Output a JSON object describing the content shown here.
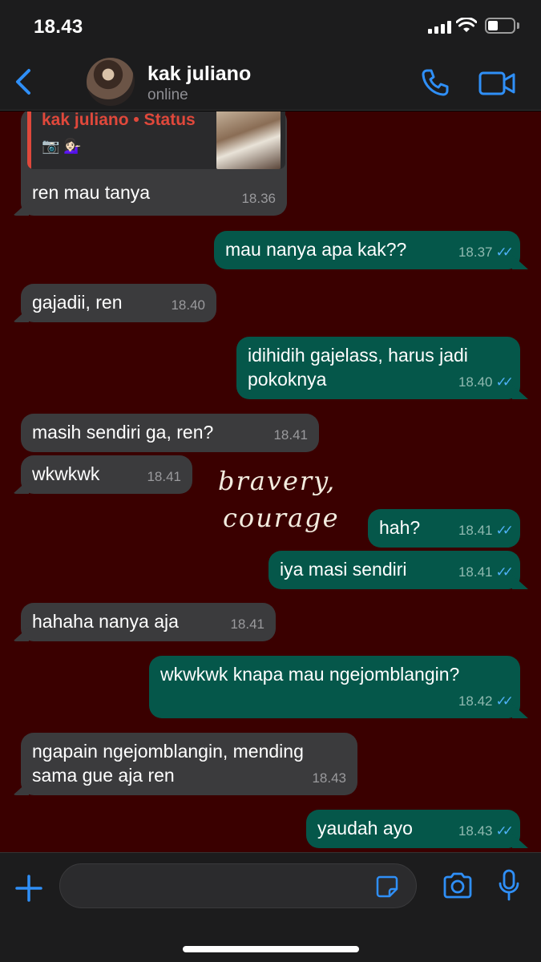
{
  "status_bar": {
    "time": "18.43"
  },
  "header": {
    "name": "kak juliano",
    "status": "online"
  },
  "quoted_status": {
    "title": "kak juliano • Status",
    "caption": "📷 💁🏻‍♀️"
  },
  "messages": [
    {
      "text": "ren mau tanya",
      "time": "18.36"
    },
    {
      "text": "mau nanya apa kak??",
      "time": "18.37"
    },
    {
      "text": "gajadii, ren",
      "time": "18.40"
    },
    {
      "text": "idihidih gajelass, harus jadi pokoknya",
      "time": "18.40"
    },
    {
      "text": "masih sendiri ga, ren?",
      "time": "18.41"
    },
    {
      "text": "wkwkwk",
      "time": "18.41"
    },
    {
      "text": "hah?",
      "time": "18.41"
    },
    {
      "text": "iya masi sendiri",
      "time": "18.41"
    },
    {
      "text": "hahaha nanya aja",
      "time": "18.41"
    },
    {
      "text": "wkwkwk knapa mau ngejomblangin?",
      "time": "18.42"
    },
    {
      "text": "ngapain ngejomblangin, mending sama gue aja ren",
      "time": "18.43"
    },
    {
      "text": "yaudah ayo",
      "time": "18.43"
    }
  ],
  "overlay_text": {
    "line1": "bravery,",
    "line2": "courage"
  },
  "input": {
    "placeholder": ""
  },
  "colors": {
    "accent": "#2f8ff7",
    "chat_bg": "#3a0000",
    "incoming": "#3b3b3d",
    "outgoing": "#05574a",
    "read_tick": "#4fb1f7",
    "quote_name": "#e0483b"
  },
  "icons": [
    "back-chevron-icon",
    "phone-icon",
    "video-camera-icon",
    "plus-icon",
    "sticker-icon",
    "camera-icon",
    "microphone-icon"
  ]
}
